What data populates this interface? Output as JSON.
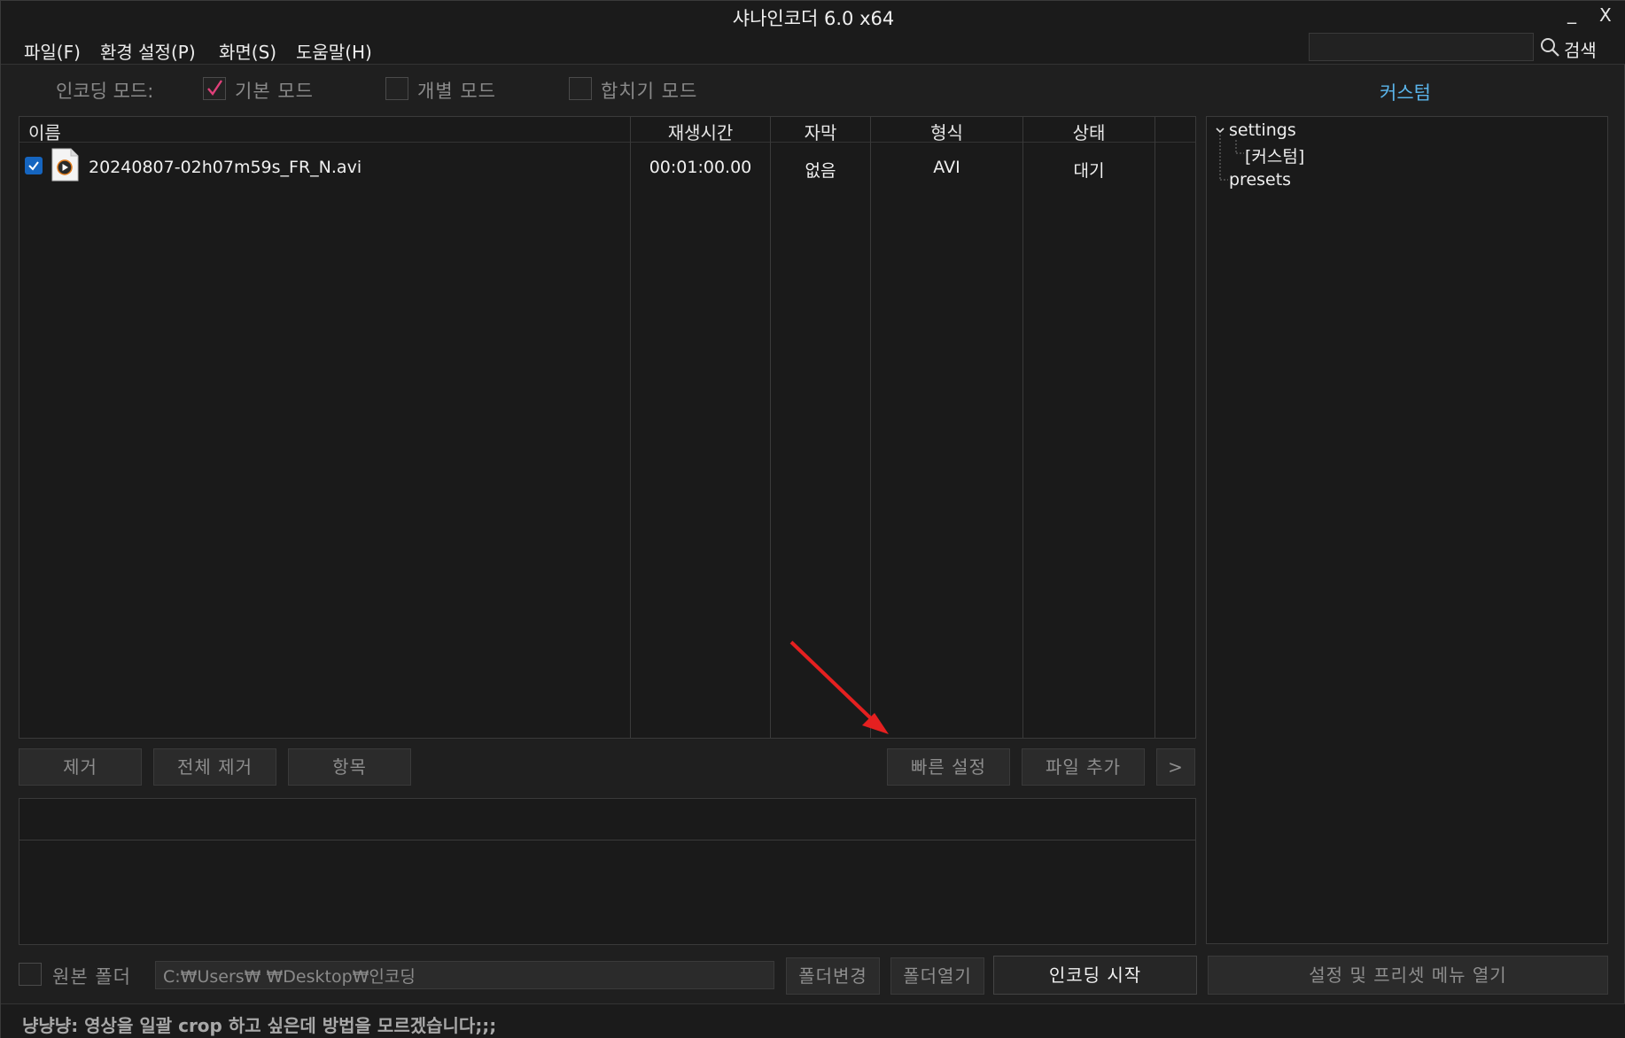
{
  "window": {
    "title": "샤나인코더  6.0 x64",
    "minimize_label": "_",
    "close_label": "X"
  },
  "menu": {
    "file": "파일(F)",
    "settings": "환경 설정(P)",
    "view": "화면(S)",
    "help": "도움말(H)"
  },
  "search": {
    "value": "",
    "label": "검색"
  },
  "mode": {
    "label": "인코딩 모드:",
    "basic": "기본 모드",
    "individual": "개별 모드",
    "merge": "합치기 모드",
    "basic_checked": true,
    "individual_checked": false,
    "merge_checked": false
  },
  "custom_title": "커스텀",
  "file_list": {
    "columns": [
      "이름",
      "재생시간",
      "자막",
      "형식",
      "상태"
    ],
    "rows": [
      {
        "checked": true,
        "name": "20240807-02h07m59s_FR_N.avi",
        "duration": "00:01:00.00",
        "subtitle": "없음",
        "format": "AVI",
        "status": "대기"
      }
    ]
  },
  "buttons": {
    "remove": "제거",
    "remove_all": "전체 제거",
    "items": "항목",
    "quick_settings": "빠른 설정",
    "add_file": "파일 추가",
    "more": ">",
    "change_folder": "폴더변경",
    "open_folder": "폴더열기",
    "start_encoding": "인코딩 시작",
    "open_settings_menu": "설정 및 프리셋 메뉴 열기"
  },
  "output": {
    "source_folder_label": "원본 폴더",
    "source_folder_checked": false,
    "path": "C:₩Users₩        ₩Desktop₩인코딩"
  },
  "tree": {
    "root": "settings",
    "child": "[커스텀]",
    "sibling": "presets"
  },
  "status_bar": {
    "text": "냥냥냥: 영상을 일괄 crop 하고 싶은데 방법을 모르겠습니다;;;"
  },
  "colors": {
    "accent": "#5ab4ea",
    "check_blue": "#1565c0",
    "check_pink": "#e0407a",
    "arrow": "#e52020"
  }
}
